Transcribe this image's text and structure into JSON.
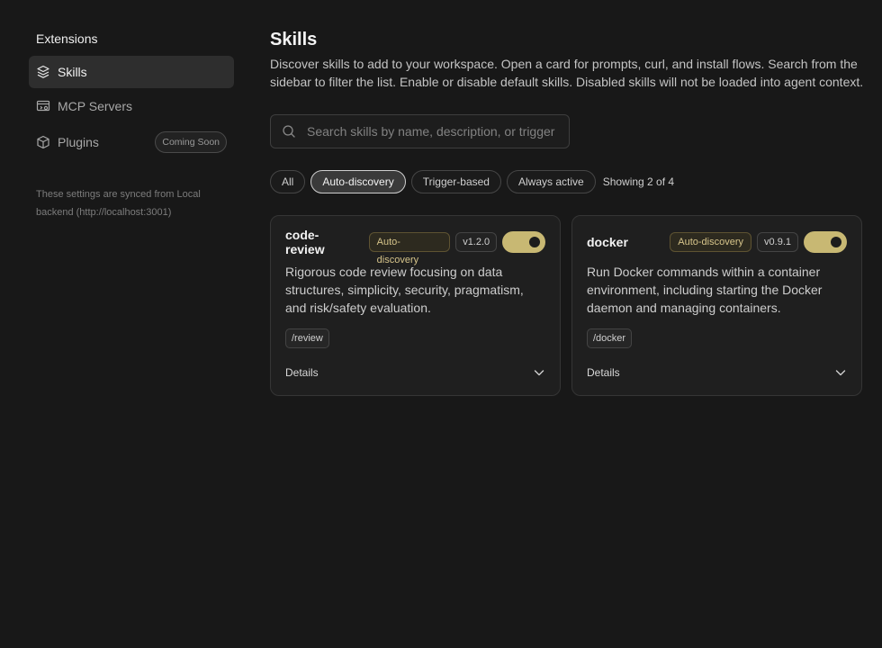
{
  "sidebar": {
    "title": "Extensions",
    "items": [
      {
        "label": "Skills",
        "icon": "layers-icon",
        "active": true
      },
      {
        "label": "MCP Servers",
        "icon": "server-icon",
        "active": false
      },
      {
        "label": "Plugins",
        "icon": "package-icon",
        "active": false,
        "badge": "Coming Soon"
      }
    ],
    "sync_note": "These settings are synced from Local backend (http://localhost:3001)"
  },
  "main": {
    "title": "Skills",
    "description": "Discover skills to add to your workspace. Open a card for prompts, curl, and install flows. Search from the sidebar to filter the list. Enable or disable default skills. Disabled skills will not be loaded into agent context.",
    "search": {
      "placeholder": "Search skills by name, description, or trigger",
      "value": ""
    },
    "filters": [
      {
        "label": "All",
        "active": false
      },
      {
        "label": "Auto-discovery",
        "active": true
      },
      {
        "label": "Trigger-based",
        "active": false
      },
      {
        "label": "Always active",
        "active": false
      }
    ],
    "showing": "Showing 2 of 4",
    "cards": [
      {
        "name": "code-review",
        "category": "Auto-discovery",
        "version": "v1.2.0",
        "enabled": true,
        "description": "Rigorous code review focusing on data structures, simplicity, security, pragmatism, and risk/safety evaluation.",
        "trigger": "/review",
        "details_label": "Details"
      },
      {
        "name": "docker",
        "category": "Auto-discovery",
        "version": "v0.9.1",
        "enabled": true,
        "description": "Run Docker commands within a container environment, including starting the Docker daemon and managing containers.",
        "trigger": "/docker",
        "details_label": "Details"
      }
    ]
  },
  "colors": {
    "background": "#181818",
    "accent": "#c8b873",
    "card": "#1f1f1f"
  }
}
